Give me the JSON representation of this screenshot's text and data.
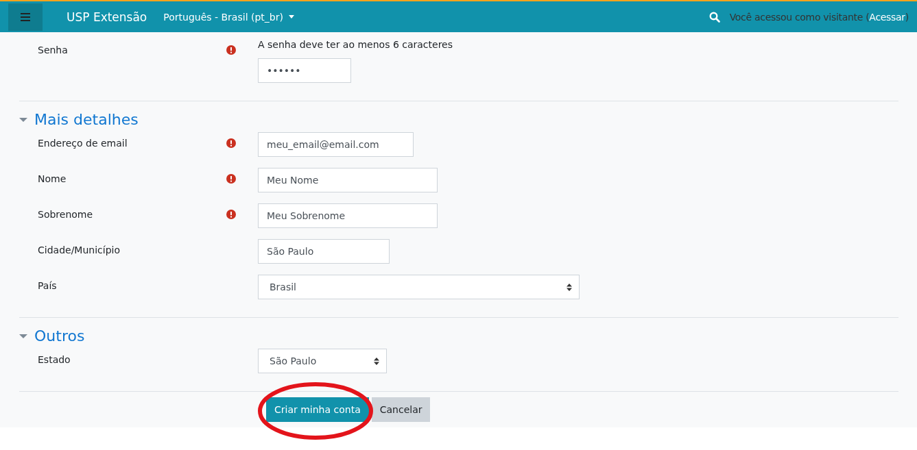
{
  "navbar": {
    "brand": "USP Extensão",
    "language": "Português - Brasil (pt_br)",
    "login_text": "Você acessou como visitante (",
    "login_link": "Acessar",
    "login_close": ")"
  },
  "sections": [
    {
      "fields": [
        {
          "kind": "password",
          "label": "Senha",
          "required": true,
          "hint": "A senha deve ter ao menos 6 caracteres",
          "value": "••••••"
        }
      ]
    },
    {
      "title": "Mais detalhes",
      "expanded": true,
      "fields": [
        {
          "kind": "text",
          "label": "Endereço de email",
          "required": true,
          "value": "meu_email@email.com"
        },
        {
          "kind": "text",
          "label": "Nome",
          "required": true,
          "value": "Meu Nome"
        },
        {
          "kind": "text",
          "label": "Sobrenome",
          "required": true,
          "value": "Meu Sobrenome"
        },
        {
          "kind": "text",
          "label": "Cidade/Município",
          "required": false,
          "value": "São Paulo"
        },
        {
          "kind": "select",
          "label": "País",
          "required": false,
          "value": "Brasil"
        }
      ]
    },
    {
      "title": "Outros",
      "expanded": true,
      "fields": [
        {
          "kind": "select",
          "label": "Estado",
          "required": false,
          "value": "São Paulo"
        }
      ]
    }
  ],
  "buttons": [
    {
      "label": "Criar minha conta",
      "kind": "primary"
    },
    {
      "label": "Cancelar",
      "kind": "secondary"
    }
  ]
}
